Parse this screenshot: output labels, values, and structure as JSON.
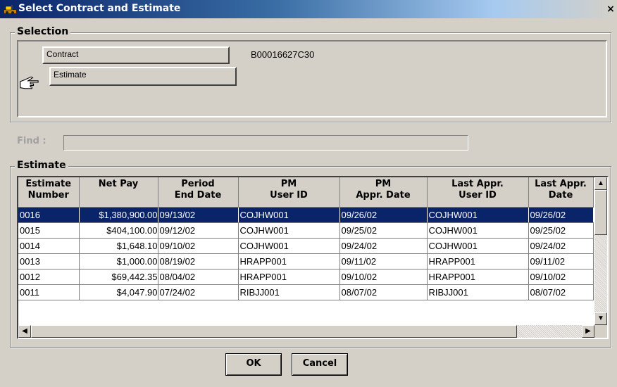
{
  "window": {
    "title": "Select Contract and Estimate",
    "close_label": "×"
  },
  "selection": {
    "group_label": "Selection",
    "contract_label": "Contract",
    "contract_value": "B00016627C30",
    "estimate_label": "Estimate"
  },
  "find": {
    "label": "Find :",
    "value": ""
  },
  "estimate": {
    "group_label": "Estimate",
    "columns": [
      "Estimate\nNumber",
      "Net Pay",
      "Period\nEnd Date",
      "PM\nUser ID",
      "PM\nAppr. Date",
      "Last Appr.\nUser ID",
      "Last Appr.\nDate"
    ],
    "rows": [
      [
        "0016",
        "$1,380,900.00",
        "09/13/02",
        "COJHW001",
        "09/26/02",
        "COJHW001",
        "09/26/02"
      ],
      [
        "0015",
        "$404,100.00",
        "09/12/02",
        "COJHW001",
        "09/25/02",
        "COJHW001",
        "09/25/02"
      ],
      [
        "0014",
        "$1,648.10",
        "09/10/02",
        "COJHW001",
        "09/24/02",
        "COJHW001",
        "09/24/02"
      ],
      [
        "0013",
        "$1,000.00",
        "08/19/02",
        "HRAPP001",
        "09/11/02",
        "HRAPP001",
        "09/11/02"
      ],
      [
        "0012",
        "$69,442.35",
        "08/04/02",
        "HRAPP001",
        "09/10/02",
        "HRAPP001",
        "09/10/02"
      ],
      [
        "0011",
        "$4,047.90",
        "07/24/02",
        "RIBJJ001",
        "08/07/02",
        "RIBJJ001",
        "08/07/02"
      ]
    ],
    "selected_row": 0
  },
  "buttons": {
    "ok_label": "OK",
    "cancel_label": "Cancel"
  },
  "icons": {
    "window_icon": "construction-icon",
    "pointer": "pointing-hand-icon",
    "close": "close-icon"
  }
}
